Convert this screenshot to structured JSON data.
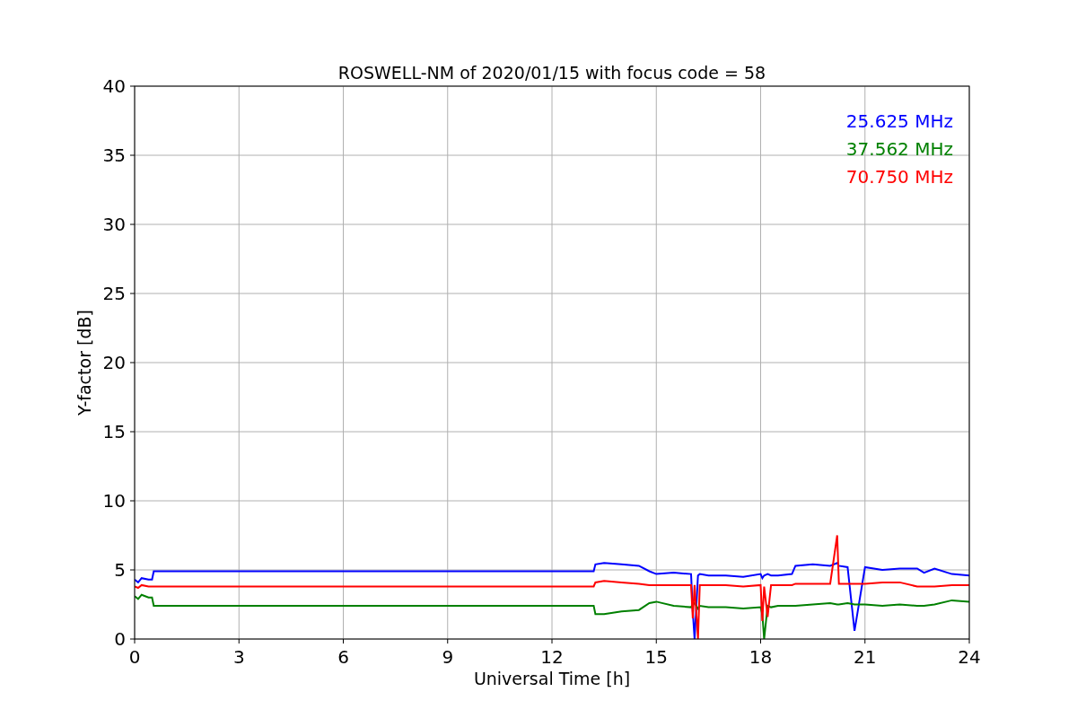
{
  "figure": {
    "chart_data": {
      "type": "line",
      "title": "ROSWELL-NM of 2020/01/15 with focus code = 58",
      "xlabel": "Universal Time [h]",
      "ylabel": "Y-factor [dB]",
      "x": [
        0,
        0.1,
        0.2,
        0.4,
        0.5,
        0.55,
        13.2,
        13.25,
        13.5,
        14,
        14.5,
        14.8,
        15,
        15.5,
        16,
        16.05,
        16.1,
        16.2,
        16.25,
        16.5,
        17,
        17.5,
        18,
        18.05,
        18.1,
        18.2,
        18.3,
        18.5,
        18.9,
        19,
        19.5,
        20,
        20.2,
        20.25,
        20.5,
        20.7,
        21,
        21.5,
        22,
        22.5,
        22.7,
        23,
        23.5,
        24
      ],
      "series": [
        {
          "name": "25.625 MHz",
          "color": "#0000ff",
          "values": [
            4.3,
            4.1,
            4.4,
            4.3,
            4.3,
            4.9,
            4.9,
            5.4,
            5.5,
            5.4,
            5.3,
            4.9,
            4.7,
            4.8,
            4.7,
            2.0,
            0.0,
            4.6,
            4.7,
            4.6,
            4.6,
            4.5,
            4.7,
            4.4,
            4.6,
            4.7,
            4.6,
            4.6,
            4.7,
            5.3,
            5.4,
            5.3,
            5.5,
            5.3,
            5.2,
            0.6,
            5.2,
            5.0,
            5.1,
            5.1,
            4.8,
            5.1,
            4.7,
            4.6
          ]
        },
        {
          "name": "37.562 MHz",
          "color": "#008000",
          "values": [
            3.1,
            2.9,
            3.2,
            3.0,
            3.0,
            2.4,
            2.4,
            1.8,
            1.8,
            2.0,
            2.1,
            2.6,
            2.7,
            2.4,
            2.3,
            2.5,
            2.6,
            2.2,
            2.4,
            2.3,
            2.3,
            2.2,
            2.3,
            1.8,
            0.0,
            2.4,
            2.3,
            2.4,
            2.4,
            2.4,
            2.5,
            2.6,
            2.5,
            2.5,
            2.6,
            2.5,
            2.5,
            2.4,
            2.5,
            2.4,
            2.4,
            2.5,
            2.8,
            2.7
          ]
        },
        {
          "name": "70.750 MHz",
          "color": "#ff0000",
          "values": [
            3.8,
            3.7,
            3.9,
            3.8,
            3.8,
            3.8,
            3.8,
            4.1,
            4.2,
            4.1,
            4.0,
            3.9,
            3.9,
            3.9,
            3.9,
            1.5,
            3.9,
            0.0,
            3.9,
            3.9,
            3.9,
            3.8,
            3.9,
            1.3,
            3.8,
            1.6,
            3.9,
            3.9,
            3.9,
            4.0,
            4.0,
            4.0,
            7.5,
            4.0,
            4.0,
            4.0,
            4.0,
            4.1,
            4.1,
            3.8,
            3.8,
            3.8,
            3.9,
            3.9
          ]
        }
      ],
      "xlim": [
        0,
        24
      ],
      "ylim": [
        0,
        40
      ],
      "xticks": [
        0,
        3,
        6,
        9,
        12,
        15,
        18,
        21,
        24
      ],
      "yticks": [
        0,
        5,
        10,
        15,
        20,
        25,
        30,
        35,
        40
      ],
      "grid": true
    }
  }
}
